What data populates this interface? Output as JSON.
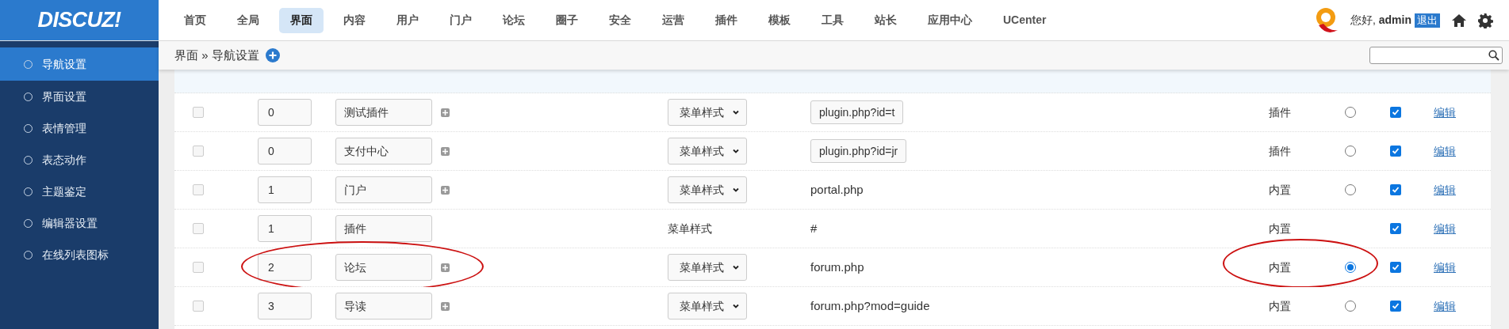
{
  "header": {
    "logo": "DISCUZ!",
    "greeting": "您好,",
    "user": "admin",
    "logout": "退出"
  },
  "nav": [
    {
      "label": "首页",
      "selected": false
    },
    {
      "label": "全局",
      "selected": false
    },
    {
      "label": "界面",
      "selected": true
    },
    {
      "label": "内容",
      "selected": false
    },
    {
      "label": "用户",
      "selected": false
    },
    {
      "label": "门户",
      "selected": false
    },
    {
      "label": "论坛",
      "selected": false
    },
    {
      "label": "圈子",
      "selected": false
    },
    {
      "label": "安全",
      "selected": false
    },
    {
      "label": "运营",
      "selected": false
    },
    {
      "label": "插件",
      "selected": false
    },
    {
      "label": "模板",
      "selected": false
    },
    {
      "label": "工具",
      "selected": false
    },
    {
      "label": "站长",
      "selected": false
    },
    {
      "label": "应用中心",
      "selected": false
    },
    {
      "label": "UCenter",
      "selected": false
    }
  ],
  "breadcrumb": {
    "section": "界面",
    "separator": "»",
    "page": "导航设置"
  },
  "sidebar": {
    "items": [
      {
        "label": "导航设置",
        "selected": true
      },
      {
        "label": "界面设置",
        "selected": false
      },
      {
        "label": "表情管理",
        "selected": false
      },
      {
        "label": "表态动作",
        "selected": false
      },
      {
        "label": "主题鉴定",
        "selected": false
      },
      {
        "label": "编辑器设置",
        "selected": false
      },
      {
        "label": "在线列表图标",
        "selected": false
      }
    ]
  },
  "rows": [
    {
      "delete": false,
      "order": "0",
      "name": "测试插件",
      "name_focused": false,
      "addable": true,
      "style": {
        "kind": "select",
        "value": "菜单样式"
      },
      "url": {
        "kind": "input",
        "value": "plugin.php?id=t"
      },
      "type": "插件",
      "default": false,
      "enabled": true,
      "edit": "编辑",
      "hover": false,
      "circled": false
    },
    {
      "delete": false,
      "order": "0",
      "name": "支付中心",
      "name_focused": false,
      "addable": true,
      "style": {
        "kind": "select",
        "value": "菜单样式"
      },
      "url": {
        "kind": "input",
        "value": "plugin.php?id=jr"
      },
      "type": "插件",
      "default": false,
      "enabled": true,
      "edit": "编辑",
      "hover": false,
      "circled": false
    },
    {
      "delete": false,
      "order": "1",
      "name": "门户",
      "name_focused": false,
      "addable": true,
      "style": {
        "kind": "select",
        "value": "菜单样式"
      },
      "url": {
        "kind": "text",
        "value": "portal.php"
      },
      "type": "内置",
      "default": false,
      "enabled": true,
      "edit": "编辑",
      "hover": false,
      "circled": false
    },
    {
      "delete": false,
      "order": "1",
      "name": "插件",
      "name_focused": false,
      "addable": false,
      "style": {
        "kind": "text",
        "value": "菜单样式"
      },
      "url": {
        "kind": "text",
        "value": "#"
      },
      "type": "内置",
      "enabled": true,
      "edit": "编辑",
      "hover": false,
      "circled": false
    },
    {
      "delete": false,
      "order": "2",
      "name": "论坛",
      "name_focused": false,
      "addable": true,
      "style": {
        "kind": "select",
        "value": "菜单样式"
      },
      "url": {
        "kind": "text",
        "value": "forum.php"
      },
      "type": "内置",
      "default": true,
      "enabled": true,
      "edit": "编辑",
      "hover": false,
      "circled": true
    },
    {
      "delete": false,
      "order": "3",
      "name": "导读",
      "name_focused": false,
      "addable": true,
      "style": {
        "kind": "select",
        "value": "菜单样式"
      },
      "url": {
        "kind": "text",
        "value": "forum.php?mod=guide"
      },
      "type": "内置",
      "default": false,
      "enabled": true,
      "edit": "编辑",
      "hover": false,
      "circled": false
    }
  ]
}
